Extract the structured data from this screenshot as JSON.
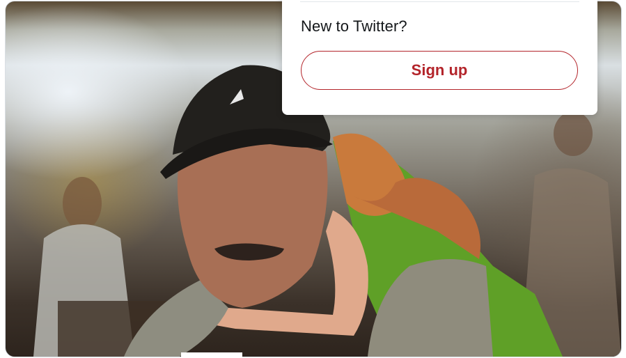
{
  "popover": {
    "question": "New to Twitter?",
    "signup_label": "Sign up"
  },
  "colors": {
    "accent": "#b3242a",
    "text": "#14171a",
    "divider": "#e2e6ea"
  },
  "photo": {
    "subject": "photo-elderly-man-holding-child"
  }
}
